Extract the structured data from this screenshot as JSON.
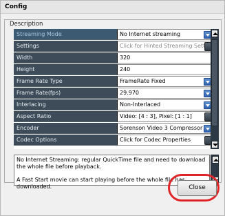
{
  "window": {
    "title": "Config"
  },
  "group": {
    "label": "Description"
  },
  "rows": [
    {
      "label": "Streaming Mode",
      "value": "No Internet streaming",
      "control": "dropdown",
      "muted": false
    },
    {
      "label": "Settings",
      "value": "Click for Hinted Streaming Settings",
      "control": "ellipsis",
      "muted": true
    },
    {
      "label": "Width",
      "value": "320",
      "control": "none",
      "muted": false
    },
    {
      "label": "Height",
      "value": "240",
      "control": "none",
      "muted": false
    },
    {
      "label": "Frame Rate Type",
      "value": "FrameRate Fixed",
      "control": "dropdown",
      "muted": false
    },
    {
      "label": "Frame Rate(fps)",
      "value": "29.970",
      "control": "dropdown",
      "muted": false
    },
    {
      "label": "Interlacing",
      "value": "Non-Interlaced",
      "control": "dropdown",
      "muted": false
    },
    {
      "label": "Aspect Ratio",
      "value": "Video: [4 : 3], Pixel: [1 : 1]",
      "control": "ellipsis",
      "muted": false
    },
    {
      "label": "Encoder",
      "value": "Sorenson Video 3 Compressor",
      "control": "dropdown",
      "muted": false
    },
    {
      "label": "Codec Options",
      "value": "Click for Codec Properties",
      "control": "ellipsis",
      "muted": false
    }
  ],
  "description": {
    "line1": "No Internet Streaming: regular QuickTime file and need to download the whole file before playback.",
    "line2": "A Fast Start movie can start playing before the whole file has downloaded."
  },
  "buttons": {
    "close": "Close"
  }
}
